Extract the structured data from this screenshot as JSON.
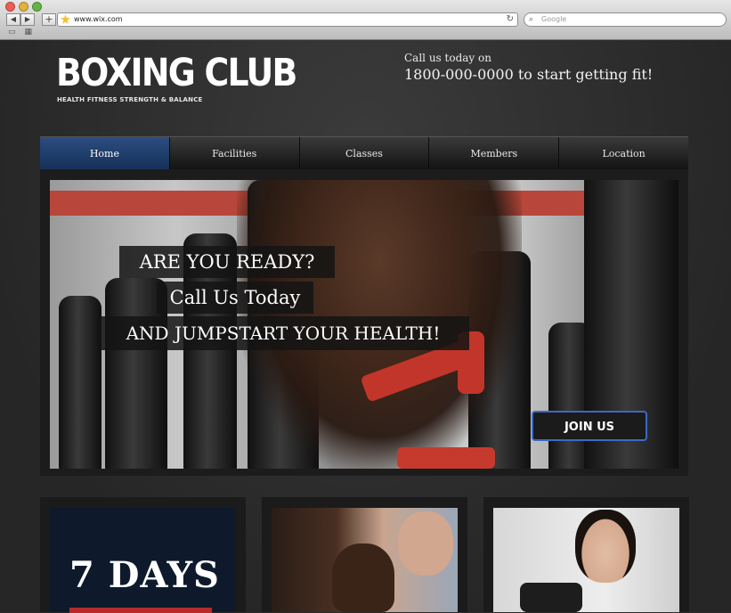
{
  "browser": {
    "url": "www.wix.com",
    "search_placeholder": "Google"
  },
  "site": {
    "logo": "BOXING CLUB",
    "tagline": "HEALTH FITNESS STRENGTH & BALANCE",
    "call_line1": "Call us today on",
    "call_line2": "1800-000-0000 to start getting fit!"
  },
  "menu": {
    "items": [
      {
        "label": "Home",
        "active": true
      },
      {
        "label": "Facilities"
      },
      {
        "label": "Classes"
      },
      {
        "label": "Members"
      },
      {
        "label": "Location"
      }
    ]
  },
  "hero": {
    "line1": "ARE YOU READY?",
    "line2": "Call Us Today",
    "line3": "AND JUMPSTART YOUR HEALTH!",
    "cta": "JOIN US"
  },
  "promo": {
    "headline": "7 DAYS"
  },
  "colors": {
    "accent": "#1f3f6e",
    "cta_border": "#3a6ac4",
    "wraps": "#c2352a"
  }
}
